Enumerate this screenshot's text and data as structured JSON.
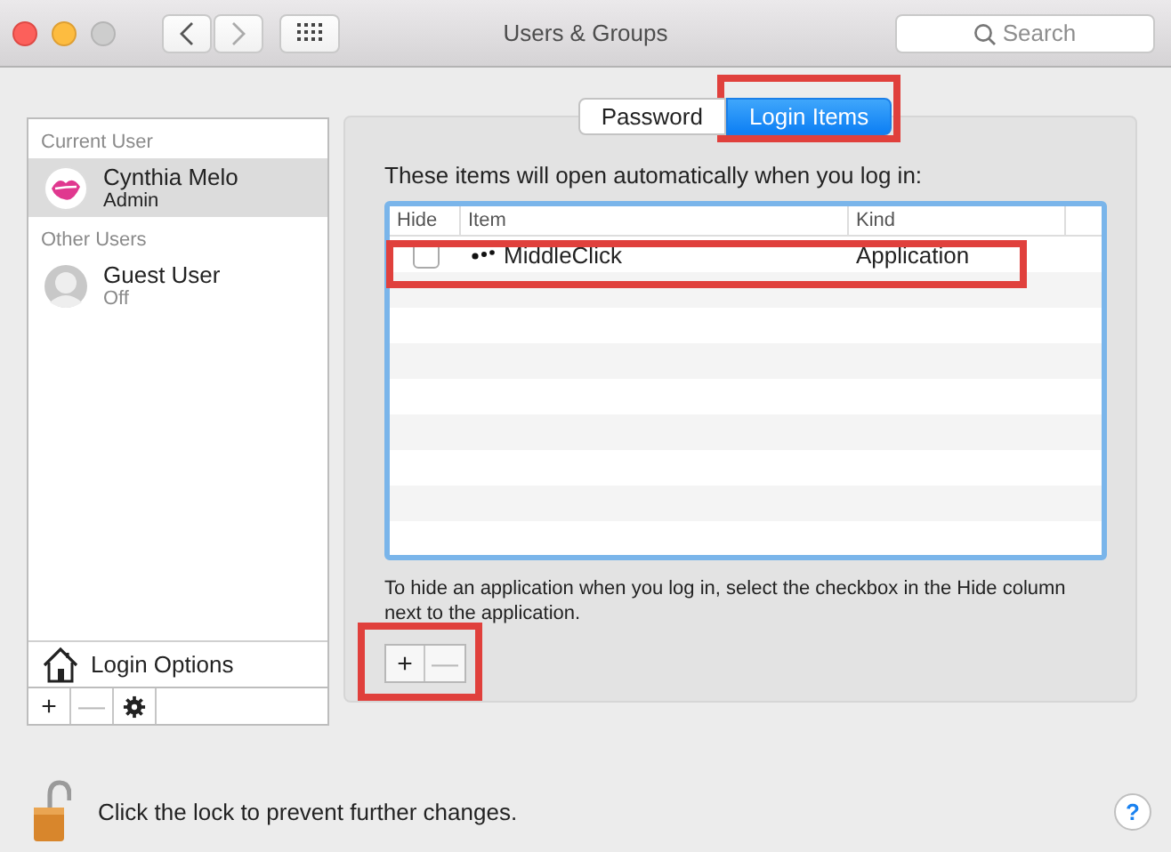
{
  "window": {
    "title": "Users & Groups",
    "search": {
      "placeholder": "Search"
    }
  },
  "sidebar": {
    "sections": [
      {
        "heading": "Current User",
        "users": [
          {
            "name": "Cynthia Melo",
            "role": "Admin",
            "selected": true,
            "kind": "custom"
          }
        ]
      },
      {
        "heading": "Other Users",
        "users": [
          {
            "name": "Guest User",
            "role": "Off",
            "selected": false,
            "kind": "generic"
          }
        ]
      }
    ],
    "login_options": "Login Options",
    "buttons": [
      {
        "label": "+",
        "disabled": false
      },
      {
        "label": "—",
        "disabled": true
      }
    ]
  },
  "tabs": [
    {
      "label": "Password",
      "selected": false
    },
    {
      "label": "Login Items",
      "selected": true
    }
  ],
  "intro": "These items will open automatically when you log in:",
  "table": {
    "columns": [
      "Hide",
      "Item",
      "Kind"
    ],
    "rows": [
      {
        "hide": false,
        "item": "MiddleClick",
        "kind": "Application"
      }
    ]
  },
  "hint": "To hide an application when you log in, select the checkbox in the Hide column next to the application.",
  "list_buttons": [
    {
      "label": "+",
      "disabled": false
    },
    {
      "label": "—",
      "disabled": true
    }
  ],
  "lock_text": "Click the lock to prevent further changes.",
  "help": "?"
}
